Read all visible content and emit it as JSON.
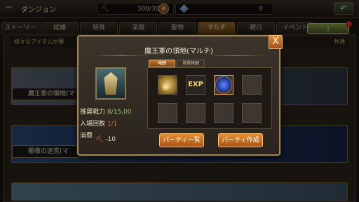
{
  "header": {
    "title": "ダンジョン",
    "stamina": "300/300",
    "stones": "0",
    "add_label": "+"
  },
  "tabs": [
    "ストーリー",
    "試練",
    "特殊",
    "深淵",
    "聖物",
    "マルチ",
    "曜日",
    "イベント"
  ],
  "filter": {
    "label": "|"
  },
  "notification_count": "!",
  "list": {
    "notice_text": "様々なアイテムが獲",
    "notice_tail": "共通",
    "banners": [
      {
        "label": "魔王軍の領地(マ"
      },
      {
        "label": "闇夜の迷宮(マ"
      },
      {
        "label": ""
      }
    ]
  },
  "dialog": {
    "title": "魔王軍の領地(マルチ)",
    "close_label": "X",
    "stats": {
      "power_label": "推奨戦力",
      "power_value": "8/15,00",
      "entry_label": "入場回数",
      "entry_value": "1/1",
      "cost_label": "消費",
      "cost_value": "-10"
    },
    "reward_tabs": [
      "報酬",
      "覚醒報酬"
    ],
    "rewards": [
      "gold",
      "EXP",
      "orb"
    ],
    "buttons": {
      "party_list": "パーティー覧",
      "party_create": "パーティ作成"
    }
  },
  "colors": {
    "accent": "#d47a24",
    "panel": "#3c342a",
    "border": "#9a8458"
  }
}
